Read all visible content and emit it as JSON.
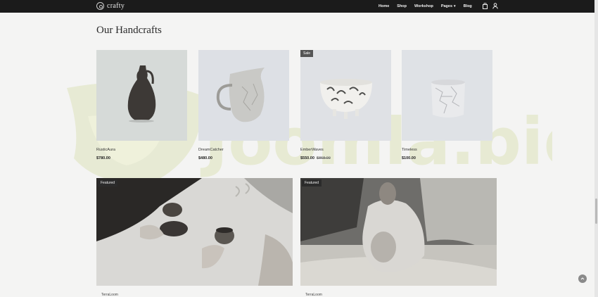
{
  "header": {
    "logo_text": "crafty",
    "nav": [
      {
        "label": "Home"
      },
      {
        "label": "Shop"
      },
      {
        "label": "Workshop"
      },
      {
        "label": "Pages",
        "has_dropdown": true
      },
      {
        "label": "Blog"
      }
    ],
    "icons": [
      "bag-icon",
      "user-icon"
    ]
  },
  "section": {
    "title": "Our Handcrafts"
  },
  "products": [
    {
      "name": "RusticAura",
      "price": "$780.00",
      "old_price": "",
      "badge": ""
    },
    {
      "name": "DreamCatcher",
      "price": "$480.00",
      "old_price": "",
      "badge": ""
    },
    {
      "name": "EmberWaves",
      "price": "$550.00",
      "old_price": "$868.00",
      "badge": "Sale"
    },
    {
      "name": "Timeless",
      "price": "$100.00",
      "old_price": "",
      "badge": ""
    }
  ],
  "featured": [
    {
      "badge": "Featured",
      "name": "TerraLoom"
    },
    {
      "badge": "Featured",
      "name": "TerraLoom"
    }
  ],
  "watermark": {
    "text": "Joomla.bid"
  },
  "colors": {
    "topbar": "#1b1b1b",
    "page_background": "#f4f4f3",
    "tile_background": "#dfe2e6",
    "watermark": "#e3e7c9"
  }
}
